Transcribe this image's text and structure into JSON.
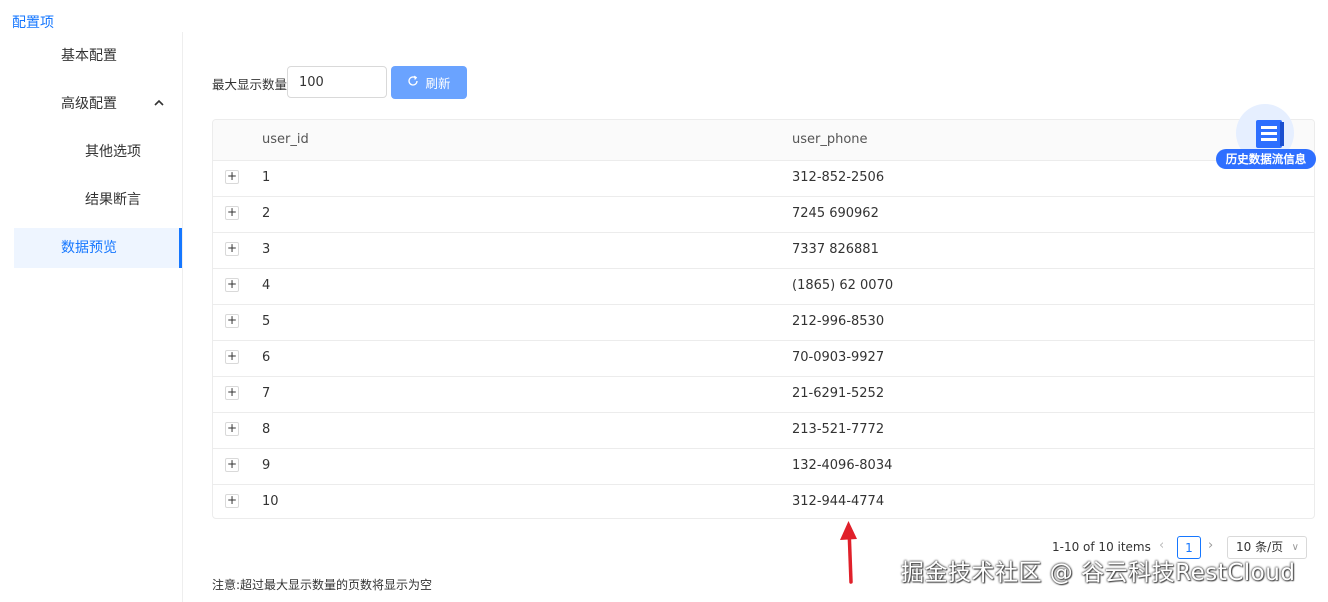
{
  "header": {
    "title": "配置项"
  },
  "sidebar": {
    "items": [
      {
        "label": "基本配置"
      },
      {
        "label": "高级配置",
        "chevron": "chevron-up-icon"
      },
      {
        "label": "其他选项"
      },
      {
        "label": "结果断言"
      },
      {
        "label": "数据预览",
        "active": true
      }
    ]
  },
  "toolbar": {
    "max_label": "最大显示数量:",
    "max_value": "100",
    "refresh_label": "刷新",
    "refresh_icon": "refresh-icon"
  },
  "table": {
    "columns": [
      "user_id",
      "user_phone"
    ],
    "rows": [
      {
        "id": "1",
        "phone": "312-852-2506"
      },
      {
        "id": "2",
        "phone": "7245 690962"
      },
      {
        "id": "3",
        "phone": "7337 826881"
      },
      {
        "id": "4",
        "phone": "(1865) 62 0070"
      },
      {
        "id": "5",
        "phone": "212-996-8530"
      },
      {
        "id": "6",
        "phone": "70-0903-9927"
      },
      {
        "id": "7",
        "phone": "21-6291-5252"
      },
      {
        "id": "8",
        "phone": "213-521-7772"
      },
      {
        "id": "9",
        "phone": "132-4096-8034"
      },
      {
        "id": "10",
        "phone": "312-944-4774"
      }
    ],
    "expand_symbol": "+"
  },
  "history": {
    "label": "历史数据流信息",
    "icon": "document-icon"
  },
  "pagination": {
    "total_text": "1-10 of 10 items",
    "current_page": "1",
    "page_size": "10 条/页",
    "prev_symbol": "‹",
    "next_symbol": "›",
    "size_chevron": "∨"
  },
  "note": "注意:超过最大显示数量的页数将显示为空",
  "watermark": "掘金技术社区 @ 谷云科技RestCloud",
  "colors": {
    "accent": "#1677ff",
    "button": "#6aa3ff",
    "arrow": "#e0202a",
    "history_badge": "#2e6fff"
  }
}
